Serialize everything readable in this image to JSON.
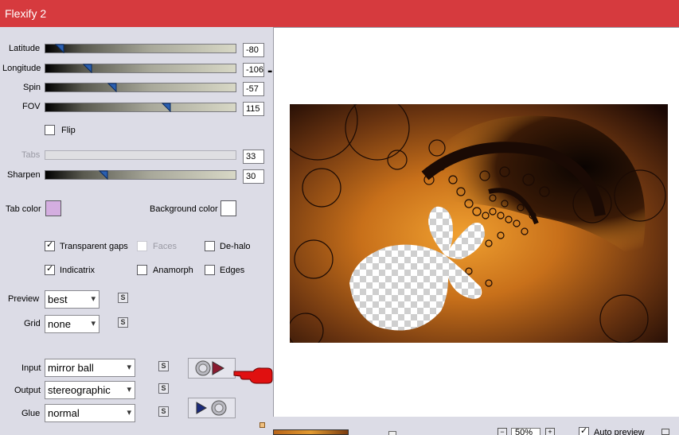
{
  "window": {
    "title": "Flexify 2"
  },
  "sliders": [
    {
      "key": "latitude",
      "label": "Latitude",
      "value": "-80",
      "level": 0.07
    },
    {
      "key": "longitude",
      "label": "Longitude",
      "value": "-106",
      "level": 0.22
    },
    {
      "key": "spin",
      "label": "Spin",
      "value": "-57",
      "level": 0.35
    },
    {
      "key": "fov",
      "label": "FOV",
      "value": "115",
      "level": 0.63
    },
    {
      "key": "tabs",
      "label": "Tabs",
      "value": "33",
      "level": 0.0,
      "disabled": true
    },
    {
      "key": "sharpen",
      "label": "Sharpen",
      "value": "30",
      "level": 0.3
    }
  ],
  "flip": {
    "label": "Flip",
    "checked": false
  },
  "tab_color": {
    "label": "Tab color",
    "color": "#d4aee0"
  },
  "background_color": {
    "label": "Background color",
    "color": "#ffffff"
  },
  "checkboxes": {
    "transparent_gaps": {
      "label": "Transparent gaps",
      "checked": true
    },
    "faces": {
      "label": "Faces",
      "checked": false,
      "disabled": true
    },
    "de_halo": {
      "label": "De-halo",
      "checked": false
    },
    "indicatrix": {
      "label": "Indicatrix",
      "checked": true
    },
    "anamorph": {
      "label": "Anamorph",
      "checked": false
    },
    "edges": {
      "label": "Edges",
      "checked": false
    }
  },
  "preview": {
    "label": "Preview",
    "value": "best"
  },
  "grid": {
    "label": "Grid",
    "value": "none"
  },
  "input": {
    "label": "Input",
    "value": "mirror ball"
  },
  "output": {
    "label": "Output",
    "value": "stereographic"
  },
  "glue": {
    "label": "Glue",
    "value": "normal"
  },
  "annotation": {
    "text": "-106"
  },
  "bottom": {
    "zoom": "50%",
    "auto_preview_label": "Auto preview",
    "auto_preview_checked": true
  },
  "colors": {
    "titlebar": "#d63a3e",
    "panel": "#dcdce6",
    "pointer": "#e01010"
  }
}
